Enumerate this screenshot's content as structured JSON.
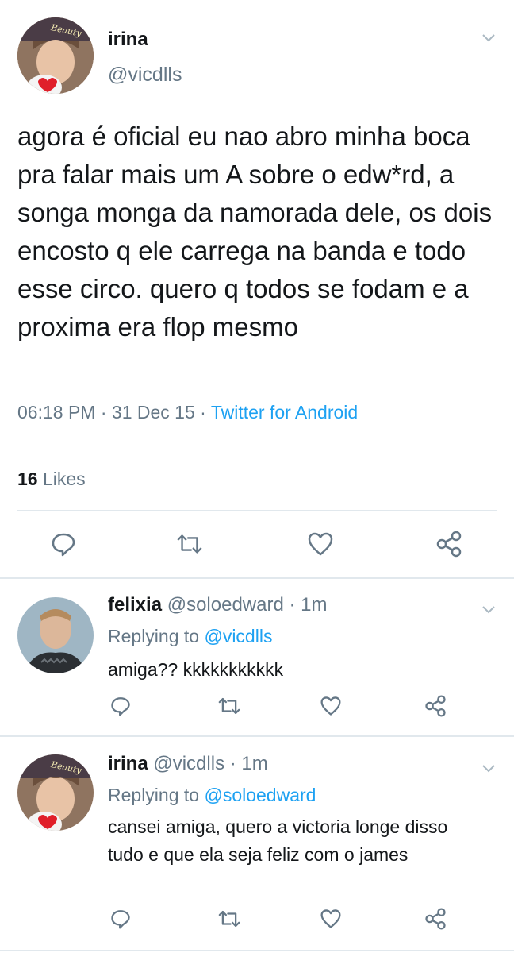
{
  "main_tweet": {
    "name": "irina",
    "handle": "@vicdlls",
    "text": "agora é oficial eu nao abro minha boca pra falar mais um A sobre o edw*rd, a songa monga da namorada dele, os dois encosto q ele carrega na banda e todo esse circo. quero q todos se fodam e a proxima era flop mesmo",
    "time": "06:18 PM",
    "date": "31 Dec 15",
    "dot": "·",
    "client": "Twitter for Android",
    "likes_count": "16",
    "likes_label": "Likes",
    "avatar_text": "Beauty"
  },
  "replies": [
    {
      "name": "felixia",
      "handle": "@soloedward",
      "dot": "·",
      "time": "1m",
      "replying_label": "Replying to",
      "replying_handle": "@vicdlls",
      "text": "amiga?? kkkkkkkkkkk"
    },
    {
      "name": "irina",
      "handle": "@vicdlls",
      "dot": "·",
      "time": "1m",
      "replying_label": "Replying to",
      "replying_handle": "@soloedward",
      "text": "cansei amiga, quero a victoria longe disso tudo e que ela seja feliz com o james",
      "avatar_text": "Beauty"
    }
  ],
  "icons": {
    "reply": "reply-icon",
    "retweet": "retweet-icon",
    "like": "heart-icon",
    "share": "share-icon",
    "menu": "chevron-down-icon"
  },
  "colors": {
    "link": "#1da1f2",
    "secondary_text": "#657786",
    "primary_text": "#14171a",
    "divider": "#e1e8ed"
  }
}
